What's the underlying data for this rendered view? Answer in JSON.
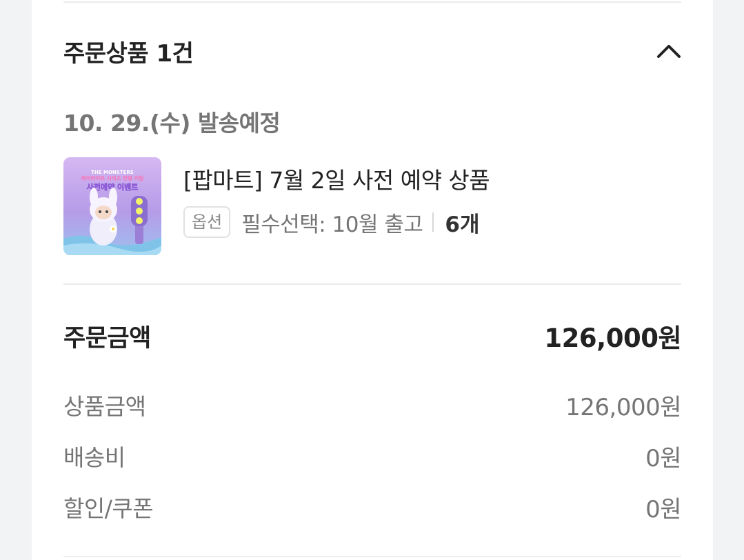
{
  "order": {
    "section_title": "주문상품 1건",
    "ship_date": "10. 29.(수) 발송예정",
    "product": {
      "thumbnail": {
        "brand_text": "THE MONSTERS",
        "line1": "하이라이트 시리즈 인형 키링",
        "line2": "사전예약 이벤트"
      },
      "name": "[팝마트] 7월 2일 사전 예약 상품",
      "option_badge": "옵션",
      "option_text": "필수선택: 10월 출고",
      "quantity": "6개"
    }
  },
  "summary": {
    "total_label": "주문금액",
    "total_value": "126,000원",
    "rows": [
      {
        "label": "상품금액",
        "value": "126,000원"
      },
      {
        "label": "배송비",
        "value": "0원"
      },
      {
        "label": "할인/쿠폰",
        "value": "0원"
      }
    ]
  },
  "colors": {
    "background": "#f2f3f5",
    "card": "#ffffff",
    "primary_text": "#222222",
    "secondary_text": "#757575",
    "divider": "#ececec"
  },
  "icons": {
    "collapse": "chevron-up-icon"
  }
}
